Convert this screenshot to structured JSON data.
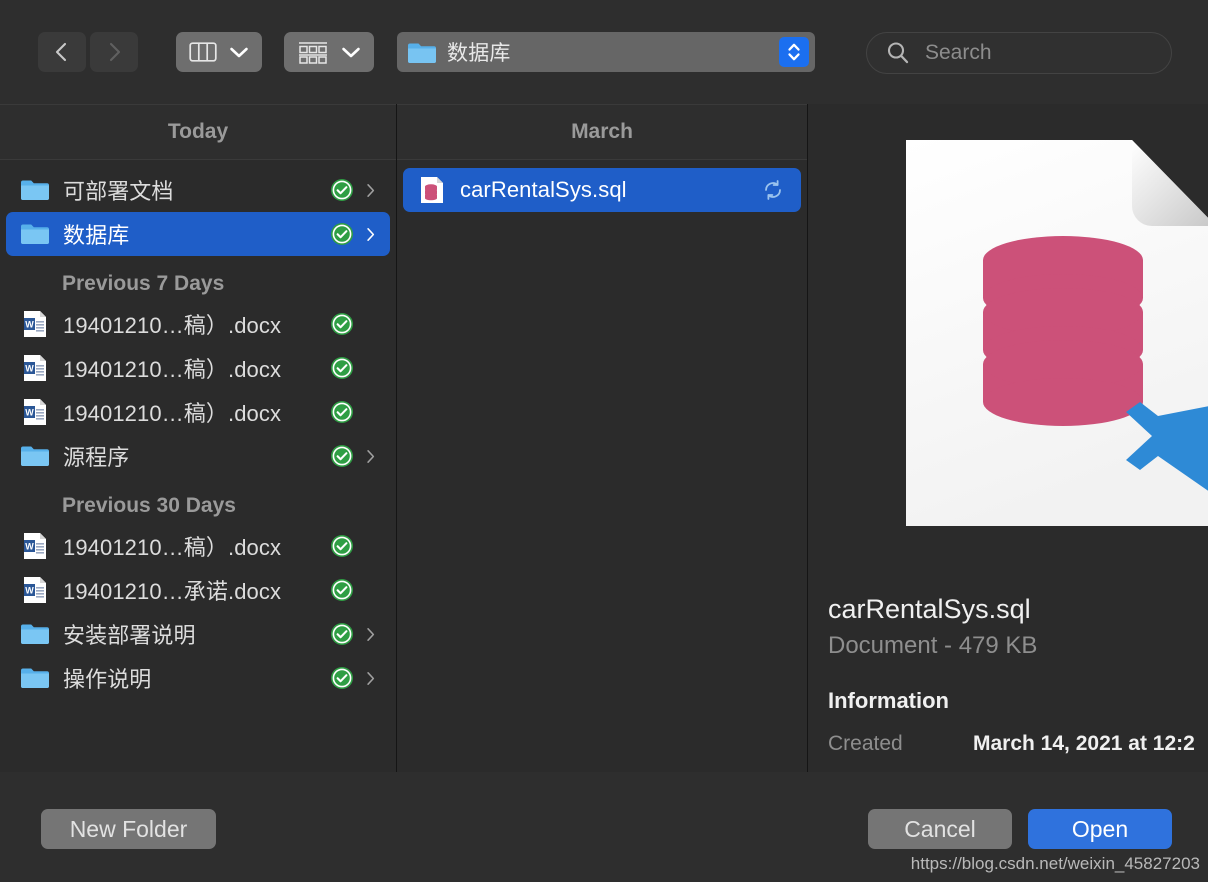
{
  "toolbar": {
    "back_icon": "chevron-left-icon",
    "forward_icon": "chevron-right-icon",
    "view_mode_icon": "column-view-icon",
    "arrange_icon": "group-arrange-icon",
    "dropdown_icon": "chevron-down-icon",
    "path": {
      "folder_icon": "folder-icon",
      "label": "数据库",
      "stepper_icon": "stepper-updown-icon"
    },
    "search": {
      "icon": "search-icon",
      "placeholder": "Search",
      "value": ""
    }
  },
  "columns": {
    "recents": {
      "header": "Today",
      "groups": [
        {
          "label": "",
          "items": [
            {
              "name": "可部署文档",
              "icon": "folder-icon",
              "badge": "icloud-downloaded-badge",
              "chevron": true,
              "selected": false
            },
            {
              "name": "数据库",
              "icon": "folder-icon",
              "badge": "icloud-downloaded-badge",
              "chevron": true,
              "selected": true
            }
          ]
        },
        {
          "label": "Previous 7 Days",
          "items": [
            {
              "name": "19401210…稿）.docx",
              "icon": "word-doc-icon",
              "badge": "icloud-downloaded-badge",
              "chevron": false,
              "selected": false
            },
            {
              "name": "19401210…稿）.docx",
              "icon": "word-doc-icon",
              "badge": "icloud-downloaded-badge",
              "chevron": false,
              "selected": false
            },
            {
              "name": "19401210…稿）.docx",
              "icon": "word-doc-icon",
              "badge": "icloud-downloaded-badge",
              "chevron": false,
              "selected": false
            },
            {
              "name": "源程序",
              "icon": "folder-icon",
              "badge": "icloud-downloaded-badge",
              "chevron": true,
              "selected": false
            }
          ]
        },
        {
          "label": "Previous 30 Days",
          "items": [
            {
              "name": "19401210…稿）.docx",
              "icon": "word-doc-icon",
              "badge": "icloud-downloaded-badge",
              "chevron": false,
              "selected": false
            },
            {
              "name": "19401210…承诺.docx",
              "icon": "word-doc-icon",
              "badge": "icloud-downloaded-badge",
              "chevron": false,
              "selected": false
            },
            {
              "name": "安装部署说明",
              "icon": "folder-icon",
              "badge": "icloud-downloaded-badge",
              "chevron": true,
              "selected": false
            },
            {
              "name": "操作说明",
              "icon": "folder-icon",
              "badge": "icloud-downloaded-badge",
              "chevron": true,
              "selected": false
            }
          ]
        }
      ]
    },
    "files": {
      "header": "March",
      "items": [
        {
          "name": "carRentalSys.sql",
          "icon": "sql-document-icon",
          "badge": "icloud-sync-icon",
          "selected": true
        }
      ]
    },
    "preview": {
      "art_icon": "sql-document-large-icon-with-vscode-badge",
      "title": "carRentalSys.sql",
      "subtitle": "Document - 479 KB",
      "section_title": "Information",
      "rows": [
        {
          "key": "Created",
          "value": "March 14, 2021 at 12:2"
        }
      ]
    }
  },
  "footer": {
    "new_folder_label": "New Folder",
    "cancel_label": "Cancel",
    "open_label": "Open",
    "watermark": "https://blog.csdn.net/weixin_45827203"
  },
  "colors": {
    "selection_blue": "#1f5ec8",
    "open_button_blue": "#2f72dd",
    "database_pink": "#cc5179",
    "badge_green": "#2f9e44",
    "vscode_blue": "#2e8ad6"
  }
}
